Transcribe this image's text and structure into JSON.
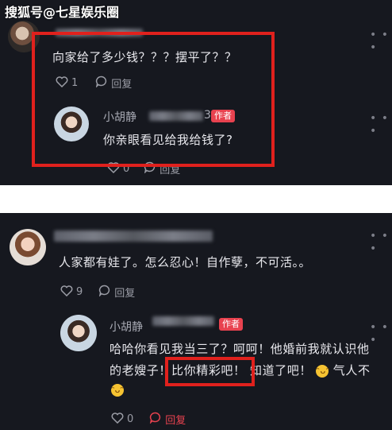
{
  "watermark": "搜狐号@七星娱乐圈",
  "comment1": {
    "text": "向家给了多少钱？？？摆平了？？",
    "likes": "1",
    "reply_label": "回复",
    "reply": {
      "author": "小胡静",
      "author_id_tail": "3",
      "badge": "作者",
      "text": "你亲眼看见给我给钱了?",
      "likes": "0",
      "reply_label": "回复"
    }
  },
  "comment2": {
    "text": "人家都有娃了。怎么忍心！自作孽，不可活。。",
    "likes": "9",
    "reply_label": "回复",
    "reply": {
      "author": "小胡静",
      "badge": "作者",
      "line1": "哈哈你看见我当三了？呵呵！他婚前我就认识他",
      "line2_a": "的老嫂子！",
      "line2_highlight": "比你精彩吧！",
      "line2_b": "知道了吧！",
      "line2_c": "气人不",
      "likes": "0",
      "reply_label": "回复"
    }
  },
  "colors": {
    "background": "#16181f",
    "highlight_box": "#e0211d",
    "author_badge": "#e8424f",
    "active_reply": "#e8424f"
  },
  "icons": [
    "heart-icon",
    "comment-bubble-icon",
    "more-dots-icon",
    "grin-emoji-icon"
  ]
}
